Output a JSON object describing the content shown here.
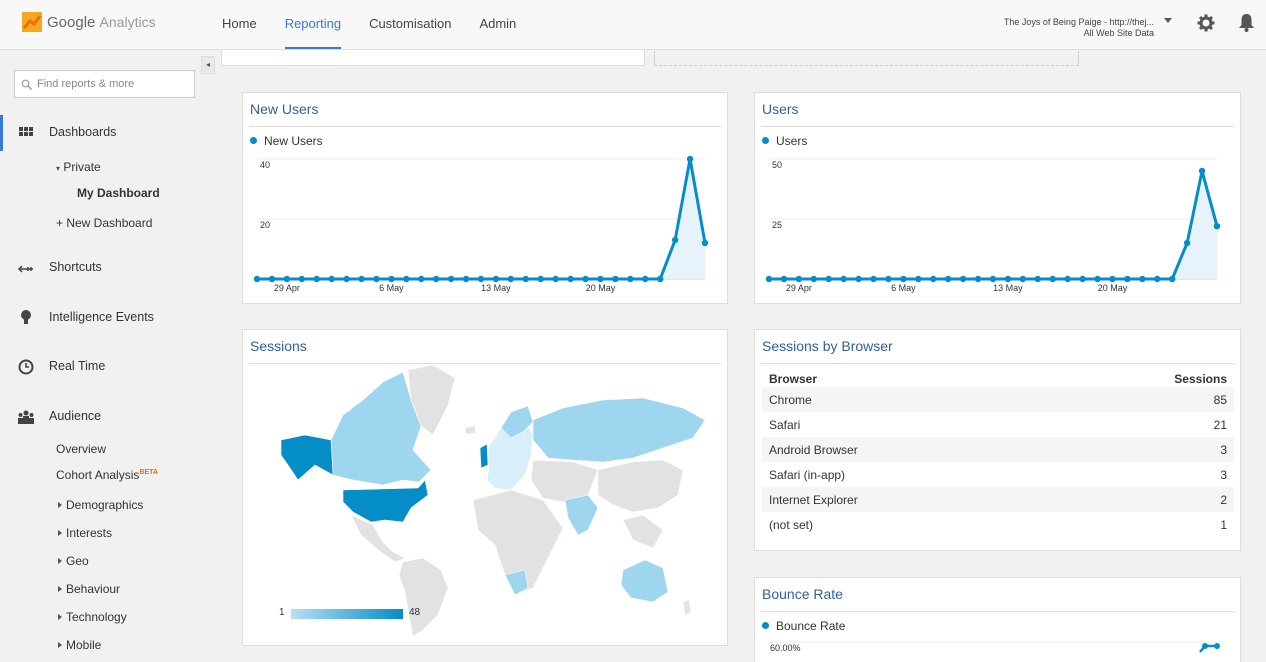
{
  "app": {
    "logo_text": "Google",
    "logo_sub": "Analytics"
  },
  "nav": {
    "tabs": [
      {
        "label": "Home"
      },
      {
        "label": "Reporting"
      },
      {
        "label": "Customisation"
      },
      {
        "label": "Admin"
      }
    ]
  },
  "account": {
    "property": "The Joys of Being Paige - http://thej...",
    "view": "All Web Site Data"
  },
  "sidebar": {
    "search_placeholder": "Find reports & more",
    "collapse_glyph": "◂",
    "dashboards": "Dashboards",
    "private": "Private",
    "my_dashboard": "My Dashboard",
    "new_dashboard": "+ New Dashboard",
    "shortcuts": "Shortcuts",
    "intelligence_events": "Intelligence Events",
    "real_time": "Real Time",
    "audience": "Audience",
    "overview": "Overview",
    "cohort_analysis": "Cohort Analysis",
    "beta": "BETA",
    "demographics": "Demographics",
    "interests": "Interests",
    "geo": "Geo",
    "behaviour": "Behaviour",
    "technology": "Technology",
    "mobile": "Mobile"
  },
  "widgets": {
    "new_users": {
      "title": "New Users",
      "legend": "New Users"
    },
    "users": {
      "title": "Users",
      "legend": "Users"
    },
    "sessions": {
      "title": "Sessions",
      "scale_min": "1",
      "scale_max": "48"
    },
    "browser": {
      "title": "Sessions by Browser",
      "col_browser": "Browser",
      "col_sessions": "Sessions",
      "rows": [
        {
          "browser": "Chrome",
          "sessions": "85"
        },
        {
          "browser": "Safari",
          "sessions": "21"
        },
        {
          "browser": "Android Browser",
          "sessions": "3"
        },
        {
          "browser": "Safari (in-app)",
          "sessions": "3"
        },
        {
          "browser": "Internet Explorer",
          "sessions": "2"
        },
        {
          "browser": "(not set)",
          "sessions": "1"
        }
      ]
    },
    "bounce": {
      "title": "Bounce Rate",
      "legend": "Bounce Rate",
      "tick": "60.00%"
    }
  },
  "chart_data": [
    {
      "type": "line",
      "series": [
        {
          "name": "New Users",
          "values": [
            0,
            0,
            0,
            0,
            0,
            0,
            0,
            0,
            0,
            0,
            0,
            0,
            0,
            0,
            0,
            0,
            0,
            0,
            0,
            0,
            0,
            0,
            0,
            0,
            0,
            0,
            0,
            0,
            13,
            40,
            12
          ]
        }
      ],
      "x_ticks": [
        "29 Apr",
        "6 May",
        "13 May",
        "20 May"
      ],
      "y_ticks": [
        "20",
        "40"
      ],
      "ylim": [
        0,
        40
      ],
      "color": "#058dc7"
    },
    {
      "type": "line",
      "series": [
        {
          "name": "Users",
          "values": [
            0,
            0,
            0,
            0,
            0,
            0,
            0,
            0,
            0,
            0,
            0,
            0,
            0,
            0,
            0,
            0,
            0,
            0,
            0,
            0,
            0,
            0,
            0,
            0,
            0,
            0,
            0,
            0,
            15,
            45,
            22
          ]
        }
      ],
      "x_ticks": [
        "29 Apr",
        "6 May",
        "13 May",
        "20 May"
      ],
      "y_ticks": [
        "25",
        "50"
      ],
      "ylim": [
        0,
        50
      ],
      "color": "#058dc7"
    }
  ]
}
